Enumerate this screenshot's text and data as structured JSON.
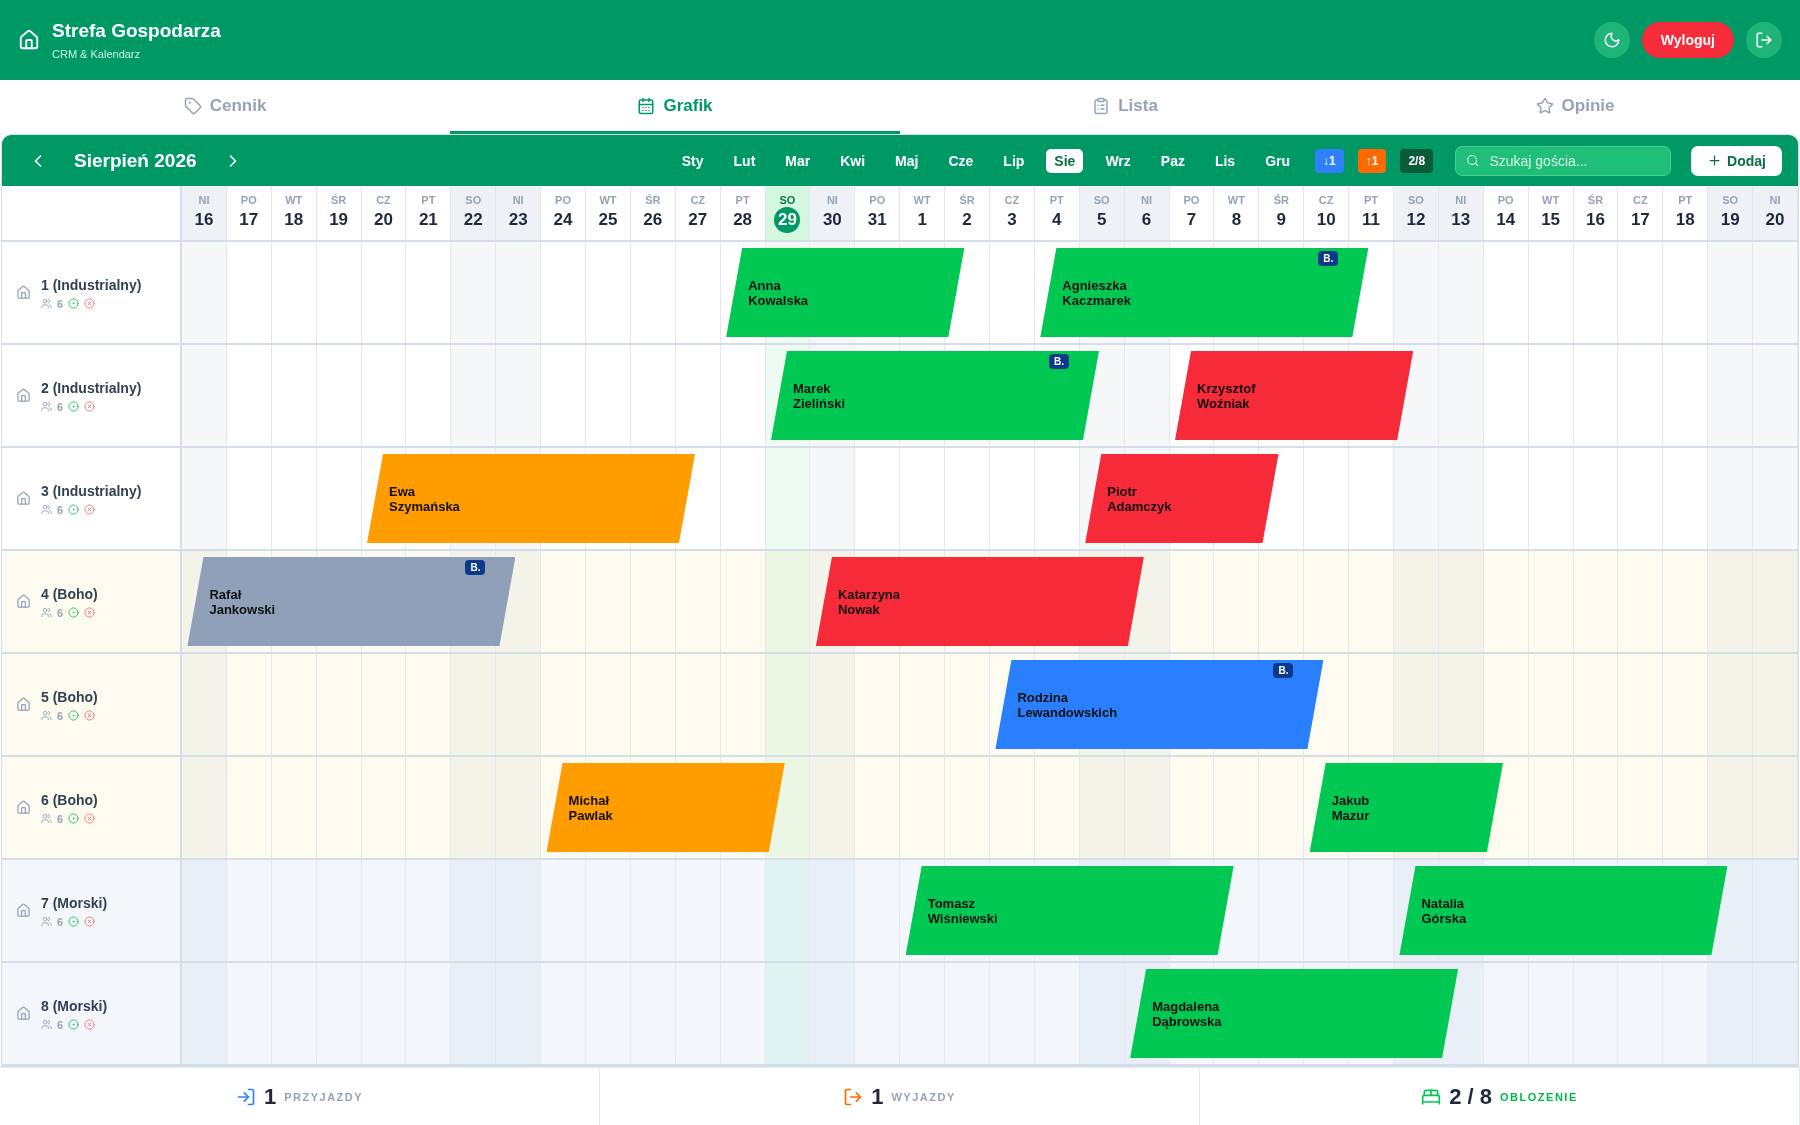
{
  "header": {
    "title": "Strefa Gospodarza",
    "subtitle": "CRM & Kalendarz",
    "logout": "Wyloguj"
  },
  "tabs": [
    {
      "label": "Cennik",
      "kind": "tag",
      "selected": false
    },
    {
      "label": "Grafik",
      "kind": "calendar",
      "selected": true
    },
    {
      "label": "Lista",
      "kind": "clipboard",
      "selected": false
    },
    {
      "label": "Opinie",
      "kind": "star",
      "selected": false
    }
  ],
  "toolbar": {
    "month_title": "Sierpień 2026",
    "months": [
      {
        "label": "Sty",
        "selected": false
      },
      {
        "label": "Lut",
        "selected": false
      },
      {
        "label": "Mar",
        "selected": false
      },
      {
        "label": "Kwi",
        "selected": false
      },
      {
        "label": "Maj",
        "selected": false
      },
      {
        "label": "Cze",
        "selected": false
      },
      {
        "label": "Lip",
        "selected": false
      },
      {
        "label": "Sie",
        "selected": true
      },
      {
        "label": "Wrz",
        "selected": false
      },
      {
        "label": "Paz",
        "selected": false
      },
      {
        "label": "Lis",
        "selected": false
      },
      {
        "label": "Gru",
        "selected": false
      }
    ],
    "counters": [
      {
        "label": "↓1",
        "color": "#2f80ff"
      },
      {
        "label": "↑1",
        "color": "#ff6a00"
      },
      {
        "label": "2/8",
        "color": "#0b5a3a"
      }
    ],
    "search": {
      "placeholder": "Szukaj gościa..."
    },
    "add_button": "Dodaj"
  },
  "days": [
    {
      "weekday": "NI",
      "day": "16",
      "weekend": true,
      "selected": false
    },
    {
      "weekday": "PO",
      "day": "17",
      "weekend": false,
      "selected": false
    },
    {
      "weekday": "WT",
      "day": "18",
      "weekend": false,
      "selected": false
    },
    {
      "weekday": "ŚR",
      "day": "19",
      "weekend": false,
      "selected": false
    },
    {
      "weekday": "CZ",
      "day": "20",
      "weekend": false,
      "selected": false
    },
    {
      "weekday": "PT",
      "day": "21",
      "weekend": false,
      "selected": false
    },
    {
      "weekday": "SO",
      "day": "22",
      "weekend": true,
      "selected": false
    },
    {
      "weekday": "NI",
      "day": "23",
      "weekend": true,
      "selected": false
    },
    {
      "weekday": "PO",
      "day": "24",
      "weekend": false,
      "selected": false
    },
    {
      "weekday": "WT",
      "day": "25",
      "weekend": false,
      "selected": false
    },
    {
      "weekday": "ŚR",
      "day": "26",
      "weekend": false,
      "selected": false
    },
    {
      "weekday": "CZ",
      "day": "27",
      "weekend": false,
      "selected": false
    },
    {
      "weekday": "PT",
      "day": "28",
      "weekend": false,
      "selected": false
    },
    {
      "weekday": "SO",
      "day": "29",
      "weekend": true,
      "selected": true
    },
    {
      "weekday": "NI",
      "day": "30",
      "weekend": true,
      "selected": false
    },
    {
      "weekday": "PO",
      "day": "31",
      "weekend": false,
      "selected": false
    },
    {
      "weekday": "WT",
      "day": "1",
      "weekend": false,
      "selected": false
    },
    {
      "weekday": "ŚR",
      "day": "2",
      "weekend": false,
      "selected": false
    },
    {
      "weekday": "CZ",
      "day": "3",
      "weekend": false,
      "selected": false
    },
    {
      "weekday": "PT",
      "day": "4",
      "weekend": false,
      "selected": false
    },
    {
      "weekday": "SO",
      "day": "5",
      "weekend": true,
      "selected": false
    },
    {
      "weekday": "NI",
      "day": "6",
      "weekend": true,
      "selected": false
    },
    {
      "weekday": "PO",
      "day": "7",
      "weekend": false,
      "selected": false
    },
    {
      "weekday": "WT",
      "day": "8",
      "weekend": false,
      "selected": false
    },
    {
      "weekday": "ŚR",
      "day": "9",
      "weekend": false,
      "selected": false
    },
    {
      "weekday": "CZ",
      "day": "10",
      "weekend": false,
      "selected": false
    },
    {
      "weekday": "PT",
      "day": "11",
      "weekend": false,
      "selected": false
    },
    {
      "weekday": "SO",
      "day": "12",
      "weekend": true,
      "selected": false
    },
    {
      "weekday": "NI",
      "day": "13",
      "weekend": true,
      "selected": false
    },
    {
      "weekday": "PO",
      "day": "14",
      "weekend": false,
      "selected": false
    },
    {
      "weekday": "WT",
      "day": "15",
      "weekend": false,
      "selected": false
    },
    {
      "weekday": "ŚR",
      "day": "16",
      "weekend": false,
      "selected": false
    },
    {
      "weekday": "CZ",
      "day": "17",
      "weekend": false,
      "selected": false
    },
    {
      "weekday": "PT",
      "day": "18",
      "weekend": false,
      "selected": false
    },
    {
      "weekday": "SO",
      "day": "19",
      "weekend": true,
      "selected": false
    },
    {
      "weekday": "NI",
      "day": "20",
      "weekend": true,
      "selected": false
    }
  ],
  "rooms": [
    {
      "name": "1 (Industrialny)",
      "capacity": "6",
      "kind": "industrial",
      "bookings": [
        {
          "guest": [
            "Anna",
            "Kowalska"
          ],
          "color": "#00c853"
        },
        {
          "guest": [
            "Agnieszka",
            "Kaczmarek"
          ],
          "color": "#00c853",
          "badge": "B."
        }
      ]
    },
    {
      "name": "2 (Industrialny)",
      "capacity": "6",
      "kind": "industrial",
      "bookings": [
        {
          "guest": [
            "Marek",
            "Zieliński"
          ],
          "color": "#00c853",
          "badge": "B."
        },
        {
          "guest": [
            "Krzysztof",
            "Woźniak"
          ],
          "color": "#f72a3a"
        }
      ]
    },
    {
      "name": "3 (Industrialny)",
      "capacity": "6",
      "kind": "industrial",
      "bookings": [
        {
          "guest": [
            "Ewa",
            "Szymańska"
          ],
          "color": "#ff9c00"
        },
        {
          "guest": [
            "Piotr",
            "Adamczyk"
          ],
          "color": "#f72a3a"
        }
      ]
    },
    {
      "name": "4 (Boho)",
      "capacity": "6",
      "kind": "boho",
      "bookings": [
        {
          "guest": [
            "Rafał",
            "Jankowski"
          ],
          "color": "#8fa0b8",
          "badge": "B."
        },
        {
          "guest": [
            "Katarzyna",
            "Nowak"
          ],
          "color": "#f72a3a"
        }
      ]
    },
    {
      "name": "5 (Boho)",
      "capacity": "6",
      "kind": "boho",
      "bookings": [
        {
          "guest": [
            "Rodzina",
            "Lewandowskich"
          ],
          "color": "#2a7fff",
          "badge": "B."
        }
      ]
    },
    {
      "name": "6 (Boho)",
      "capacity": "6",
      "kind": "boho",
      "bookings": [
        {
          "guest": [
            "Michał",
            "Pawlak"
          ],
          "color": "#ff9c00"
        },
        {
          "guest": [
            "Jakub",
            "Mazur"
          ],
          "color": "#00c853"
        }
      ]
    },
    {
      "name": "7 (Morski)",
      "capacity": "6",
      "kind": "sea",
      "bookings": [
        {
          "guest": [
            "Tomasz",
            "Wiśniewski"
          ],
          "color": "#00c853"
        },
        {
          "guest": [
            "Natalia",
            "Górska"
          ],
          "color": "#00c853"
        }
      ]
    },
    {
      "name": "8 (Morski)",
      "capacity": "6",
      "kind": "sea",
      "bookings": [
        {
          "guest": [
            "Magdalena",
            "Dąbrowska"
          ],
          "color": "#00c853"
        }
      ]
    }
  ],
  "footer": [
    {
      "kind": "arrivals",
      "value": "1",
      "label": "PRZYJAZDY",
      "color": "#2f80ff",
      "highlight": false
    },
    {
      "kind": "departures",
      "value": "1",
      "label": "WYJAZDY",
      "color": "#ff6a00",
      "highlight": false
    },
    {
      "kind": "occupancy",
      "value": "2 / 8",
      "label": "OBLOZENIE",
      "color": "#00c853",
      "highlight": true
    }
  ]
}
